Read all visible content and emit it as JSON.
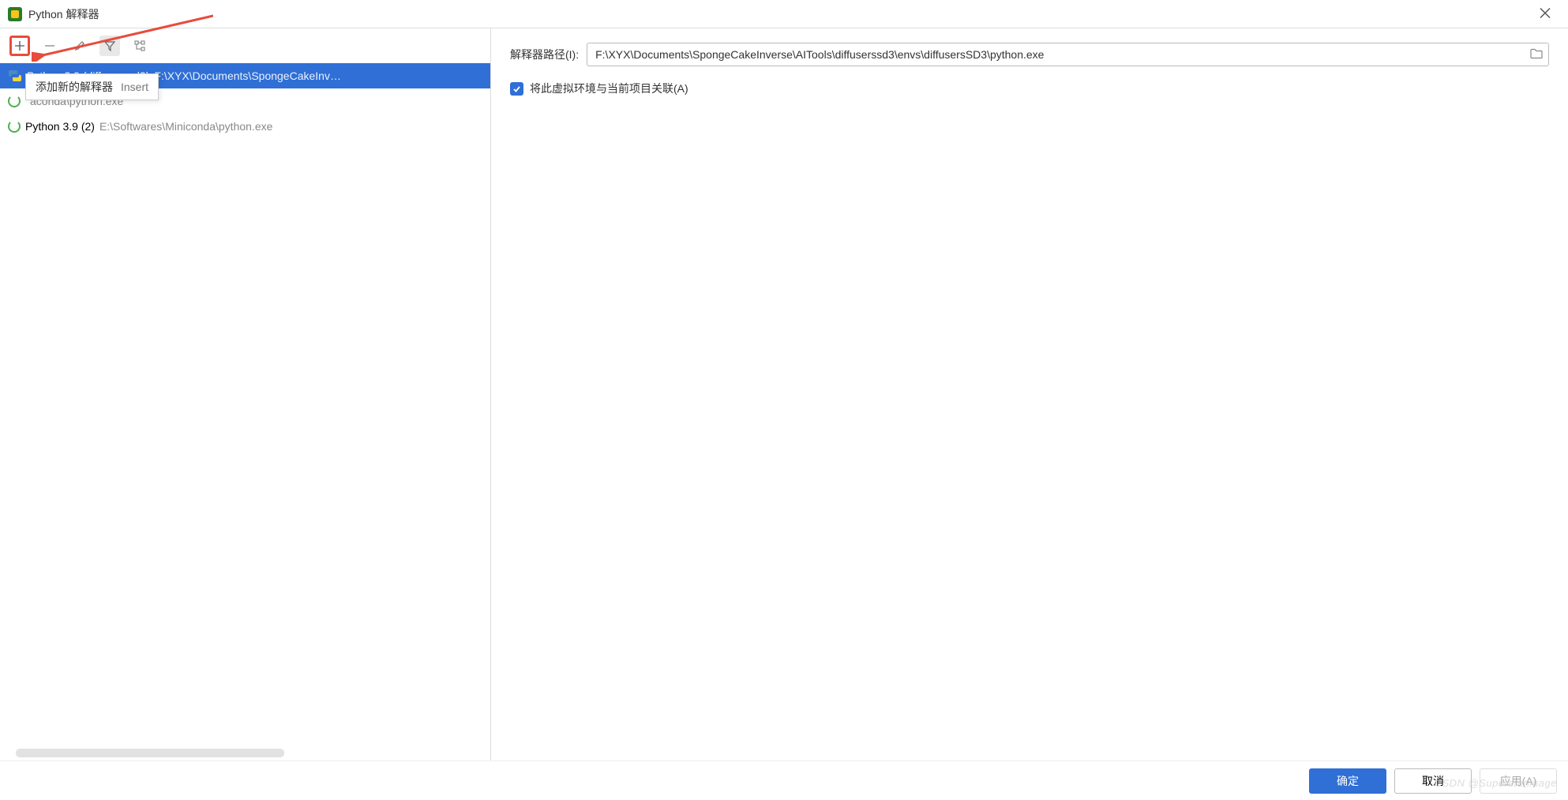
{
  "window": {
    "title": "Python 解释器"
  },
  "toolbar": {
    "tooltip_text": "添加新的解释器",
    "tooltip_shortcut": "Insert"
  },
  "interpreters": [
    {
      "name": "Python 3.9 (diffuserssd3)",
      "path": "F:\\XYX\\Documents\\SpongeCakeInv…",
      "type": "python",
      "selected": true
    },
    {
      "name": "",
      "path": "aconda\\python.exe",
      "type": "loading",
      "selected": false
    },
    {
      "name": "Python 3.9 (2)",
      "path": "E:\\Softwares\\Miniconda\\python.exe",
      "type": "loading",
      "selected": false
    }
  ],
  "details": {
    "path_label": "解释器路径(I):",
    "path_value": "F:\\XYX\\Documents\\SpongeCakeInverse\\AITools\\diffuserssd3\\envs\\diffusersSD3\\python.exe",
    "associate_checkbox_label": "将此虚拟环境与当前项目关联(A)",
    "associate_checked": true
  },
  "buttons": {
    "ok": "确定",
    "cancel": "取消",
    "apply": "应用(A)"
  },
  "watermark": "CSDN @Superstarimage"
}
